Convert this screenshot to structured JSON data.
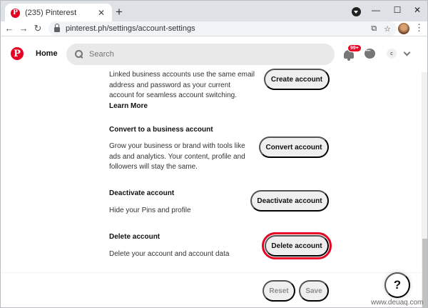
{
  "browser": {
    "tab_title": "(235) Pinterest",
    "tab_close": "✕",
    "new_tab": "+",
    "minimize": "—",
    "maximize": "☐",
    "close": "✕",
    "back": "←",
    "forward": "→",
    "reload": "↻",
    "url": "pinterest.ph/settings/account-settings",
    "menu": "⋮"
  },
  "header": {
    "logo": "P",
    "home_label": "Home",
    "search_placeholder": "Search",
    "notification_badge": "99+",
    "avatar_initial": "c"
  },
  "sections": {
    "business": {
      "description": "Linked business accounts use the same email address and password as your current account for seamless account switching.",
      "learn_more": "Learn More",
      "button": "Create account"
    },
    "convert": {
      "title": "Convert to a business account",
      "description": "Grow your business or brand with tools like ads and analytics. Your content, profile and followers will stay the same.",
      "button": "Convert account"
    },
    "deactivate": {
      "title": "Deactivate account",
      "description": "Hide your Pins and profile",
      "button": "Deactivate account"
    },
    "delete": {
      "title": "Delete account",
      "description": "Delete your account and account data",
      "button": "Delete account"
    }
  },
  "footer": {
    "reset": "Reset",
    "save": "Save",
    "help": "?"
  },
  "watermark": "www.deuaq.com",
  "colors": {
    "brand_red": "#e60023",
    "button_gray": "#efefef"
  }
}
